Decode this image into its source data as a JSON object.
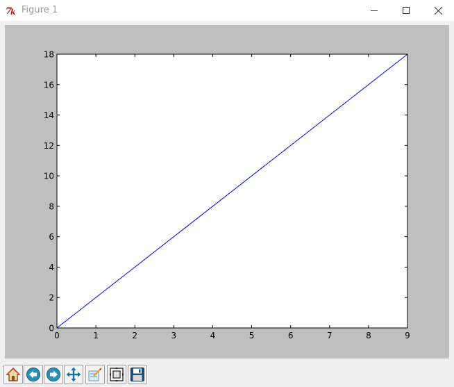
{
  "window": {
    "title": "Figure 1",
    "icon": "tk-feather-icon",
    "controls": [
      "minimize-icon",
      "maximize-icon",
      "close-icon"
    ]
  },
  "figure": {
    "background_color": "#bfbfbf",
    "axes_background": "#ffffff",
    "line_color": "#0000ff"
  },
  "chart_data": {
    "type": "line",
    "title": "",
    "xlabel": "",
    "ylabel": "",
    "x": [
      0,
      9
    ],
    "series": [
      {
        "values": [
          0,
          18
        ],
        "color": "#0000ff"
      }
    ],
    "xlim": [
      0,
      9
    ],
    "ylim": [
      0,
      18
    ],
    "xticks": [
      "0",
      "1",
      "2",
      "3",
      "4",
      "5",
      "6",
      "7",
      "8",
      "9"
    ],
    "yticks": [
      "0",
      "2",
      "4",
      "6",
      "8",
      "10",
      "12",
      "14",
      "16",
      "18"
    ],
    "grid": false,
    "legend": "none"
  },
  "toolbar": {
    "tools": [
      {
        "name": "home-icon"
      },
      {
        "name": "back-icon"
      },
      {
        "name": "forward-icon"
      },
      {
        "name": "pan-icon"
      },
      {
        "name": "zoom-icon"
      },
      {
        "name": "configure-subplots-icon"
      },
      {
        "name": "save-icon"
      }
    ]
  }
}
